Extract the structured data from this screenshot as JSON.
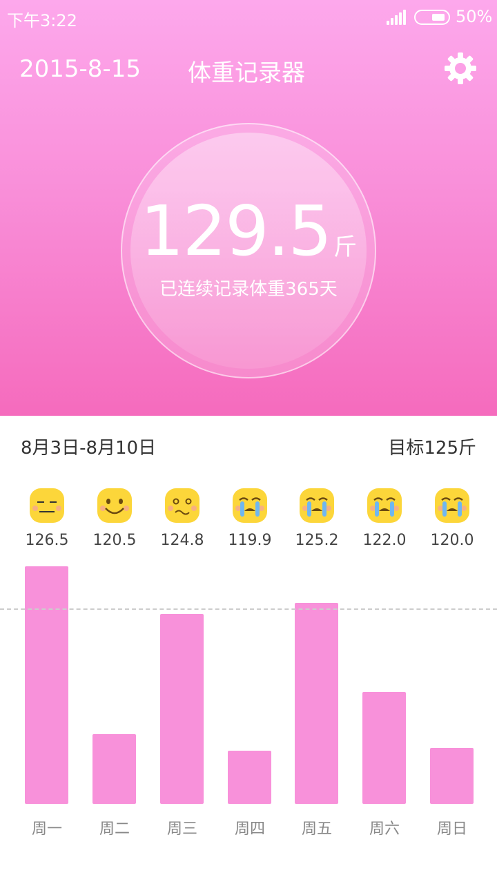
{
  "status_bar": {
    "time": "下午3:22",
    "battery": "50%"
  },
  "header": {
    "date": "2015-8-15",
    "title": "体重记录器",
    "settings_icon": "gear-icon"
  },
  "current": {
    "weight": "129.5",
    "unit": "斤",
    "streak": "已连续记录体重365天"
  },
  "week": {
    "range": "8月3日-8月10日",
    "target": "目标125斤"
  },
  "chart_data": {
    "type": "bar",
    "categories": [
      "周一",
      "周二",
      "周三",
      "周四",
      "周五",
      "周六",
      "周日"
    ],
    "values": [
      126.5,
      120.5,
      124.8,
      119.9,
      125.2,
      122.0,
      120.0
    ],
    "value_labels": [
      "126.5",
      "120.5",
      "124.8",
      "119.9",
      "125.2",
      "122.0",
      "120.0"
    ],
    "moods": [
      "meh-face-icon",
      "smile-face-icon",
      "worried-face-icon",
      "crying-face-icon",
      "crying-face-icon",
      "crying-face-icon",
      "crying-face-icon"
    ],
    "target": 125,
    "ylim": [
      118.0,
      127.0
    ],
    "bar_color": "#f891da"
  },
  "colors": {
    "header_top": "#fda8ec",
    "header_bottom": "#f56bbd",
    "bar": "#f891da",
    "face": "#fcd63a"
  }
}
